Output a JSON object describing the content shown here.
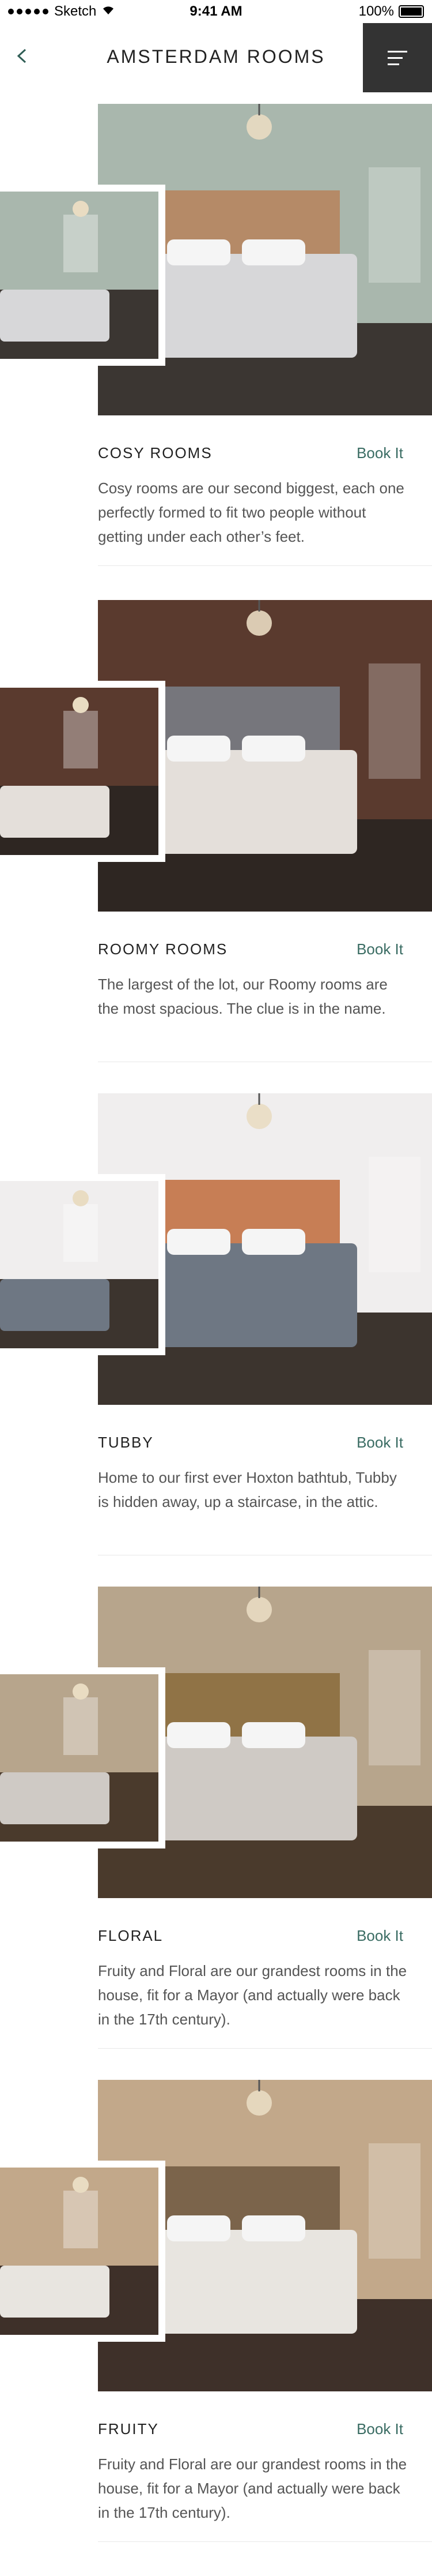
{
  "status_bar": {
    "carrier": "Sketch",
    "time": "9:41 AM",
    "battery": "100%"
  },
  "header": {
    "title": "AMSTERDAM ROOMS"
  },
  "rooms": [
    {
      "name": "COSY ROOMS",
      "book_label": "Book It",
      "description": "Cosy rooms are our second biggest, each one perfectly formed to fit two people without getting under each other’s feet.",
      "colors": {
        "wall": "#a9b7ad",
        "floor": "#3b3632",
        "bed": "#d7d7d9",
        "accent": "#b7835a"
      }
    },
    {
      "name": "ROOMY ROOMS",
      "book_label": "Book It",
      "description": "The largest of the lot, our Roomy rooms are the most spacious. The clue is in the name.",
      "colors": {
        "wall": "#5a3a2e",
        "floor": "#2e2622",
        "bed": "#e4dfda",
        "accent": "#7b818a"
      }
    },
    {
      "name": "TUBBY",
      "book_label": "Book It",
      "description": "Home to our first ever Hoxton bathtub, Tubby is hidden away, up a staircase, in the attic.",
      "colors": {
        "wall": "#f0eeee",
        "floor": "#3c342e",
        "bed": "#6e7783",
        "accent": "#c06a3a"
      }
    },
    {
      "name": "FLORAL",
      "book_label": "Book It",
      "description": "Fruity and Floral are our grandest rooms in the house, fit for a Mayor (and actually were back in the 17th century).",
      "colors": {
        "wall": "#b7a58c",
        "floor": "#4a3a2c",
        "bed": "#cfcac5",
        "accent": "#8a6a3a"
      }
    },
    {
      "name": "FRUITY",
      "book_label": "Book It",
      "description": "Fruity and Floral are our grandest rooms in the house, fit for a Mayor (and actually were back in the 17th century).",
      "colors": {
        "wall": "#c2a88a",
        "floor": "#3e3029",
        "bed": "#e8e5e0",
        "accent": "#6e5840"
      }
    }
  ]
}
